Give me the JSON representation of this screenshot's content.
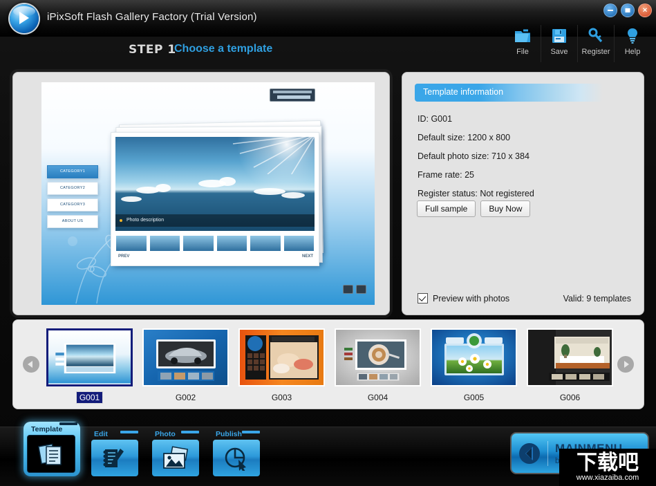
{
  "window": {
    "title": "iPixSoft Flash Gallery Factory (Trial Version)",
    "logo_icon": "play-circle-icon",
    "controls": {
      "minimize": "minimize-icon",
      "maximize": "maximize-icon",
      "close": "close-icon"
    }
  },
  "header": {
    "step_number": "STEP 1",
    "step_title": "Choose a template",
    "accent_color": "#2f9fe0"
  },
  "toolbar": {
    "items": [
      {
        "label": "File",
        "icon": "folder-icon"
      },
      {
        "label": "Save",
        "icon": "floppy-disk-icon"
      },
      {
        "label": "Register",
        "icon": "key-icon"
      },
      {
        "label": "Help",
        "icon": "lightbulb-icon"
      }
    ]
  },
  "preview": {
    "watermark_label": "template-watermark-badge",
    "photo_description": "Photo description",
    "prev_label": "PREV",
    "next_label": "NEXT",
    "categories": [
      "CATEGORY1",
      "CATEGORY2",
      "CATEGORY3",
      "ABOUT US"
    ],
    "controls": [
      "sound-icon",
      "pause-icon"
    ]
  },
  "info_panel": {
    "heading": "Template information",
    "rows": [
      "ID: G001",
      "Default size: 1200 x 800",
      "Default photo size: 710 x 384",
      "Frame rate: 25",
      "Register status: Not registered"
    ],
    "buttons": [
      {
        "label": "Full sample"
      },
      {
        "label": "Buy Now"
      }
    ],
    "checkbox_label": "Preview with photos",
    "checkbox_checked": true,
    "valid_text": "Valid: 9 templates",
    "heading_color": "#3aa6e8"
  },
  "template_strip": {
    "prev_arrow": "chevron-left-icon",
    "next_arrow": "chevron-right-icon",
    "selected_id": "G001",
    "templates": [
      {
        "id": "G001",
        "theme": "sky-sea"
      },
      {
        "id": "G002",
        "theme": "car-blue"
      },
      {
        "id": "G003",
        "theme": "sushi-orange"
      },
      {
        "id": "G004",
        "theme": "coffee-gray"
      },
      {
        "id": "G005",
        "theme": "daisy-blue"
      },
      {
        "id": "G006",
        "theme": "interior-dark"
      }
    ]
  },
  "bottom_nav": {
    "items": [
      {
        "label": "Template",
        "icon": "documents-icon",
        "active": true
      },
      {
        "label": "Edit",
        "icon": "notebook-pencil-icon",
        "active": false
      },
      {
        "label": "Photo",
        "icon": "photos-icon",
        "active": false
      },
      {
        "label": "Publish",
        "icon": "target-cursor-icon",
        "active": false
      }
    ],
    "main_menu": {
      "line1": "MAINMENU",
      "line2": "back",
      "icon": "back-arrow-icon"
    }
  },
  "watermark": {
    "text_cn": "下载吧",
    "url": "www.xiazaiba.com"
  }
}
